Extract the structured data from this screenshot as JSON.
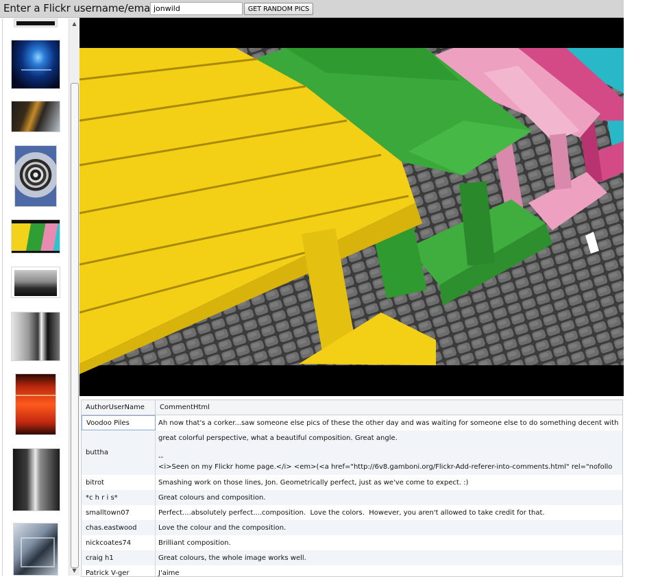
{
  "toolbar": {
    "label": "Enter a Flickr username/email:",
    "username_value": "jonwild",
    "button_label": "GET RANDOM PICS"
  },
  "grid": {
    "columns": [
      "AuthorUserName",
      "CommentHtml"
    ],
    "rows": [
      {
        "author": "Voodoo Piles",
        "comment": "Ah now that's a corker...saw someone else pics of these the other day and was waiting for someone else to do something decent with"
      },
      {
        "author": "buttha",
        "comment_lines": [
          "great colorful perspective, what a beautiful composition. Great angle.",
          "",
          "--",
          "<i>Seen on my Flickr home page.</i> <em>(<a href=\"http://6v8.gamboni.org/Flickr-Add-referer-into-comments.html\" rel=\"nofollo"
        ]
      },
      {
        "author": "bitrot",
        "comment": "Smashing work on those lines, Jon. Geometrically perfect, just as we've come to expect. :)"
      },
      {
        "author": "*c h r i s*",
        "comment": "Great colours and composition."
      },
      {
        "author": "smalltown07",
        "comment": "Perfect....absolutely perfect....composition.  Love the colors.  However, you aren't allowed to take credit for that."
      },
      {
        "author": "chas.eastwood",
        "comment": "Love the colour and the composition."
      },
      {
        "author": "nickcoates74",
        "comment": "Brilliant composition."
      },
      {
        "author": "craig h1",
        "comment": "Great colours, the whole image works well."
      },
      {
        "author": "Patrick V-ger",
        "comment": "J'aime"
      }
    ]
  },
  "icons": {
    "scroll_up": "up-arrow-icon",
    "scroll_down": "down-arrow-icon"
  }
}
